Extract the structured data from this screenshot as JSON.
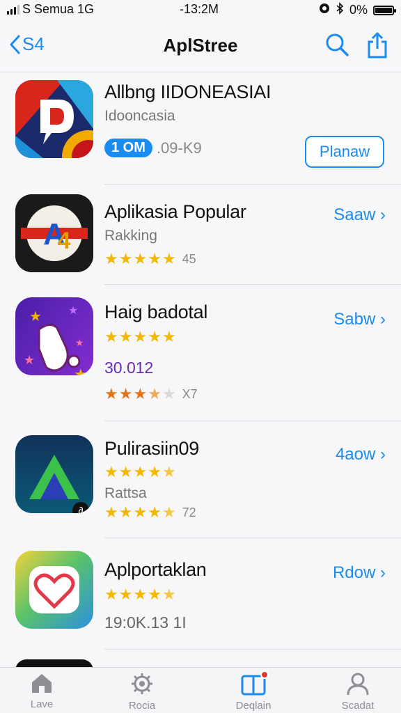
{
  "status_bar": {
    "carrier": "S Semua 1G",
    "time": "-13:2M",
    "battery": "0%"
  },
  "nav": {
    "back_label": "S4",
    "title": "AplStree"
  },
  "apps": [
    {
      "title": "Allbng IIDONEASIAI",
      "subtitle": "Idooncasia",
      "badge": "1 OM",
      "meta": ".09-K9",
      "action": "Planaw"
    },
    {
      "title": "Aplikasia Popular",
      "subtitle": "Rakking",
      "rating": 5,
      "rating_count": "45",
      "action": "Saaw ›"
    },
    {
      "title": "Haig badotal",
      "rating": 5,
      "price": "30.012",
      "rating2": 3.5,
      "rating2_count": "X7",
      "action": "Sabw ›"
    },
    {
      "title": "Pulirasiin09",
      "rating": 4.5,
      "subtitle": "Rattsa",
      "rating2": 4.5,
      "rating2_count": "72",
      "action": "4aow ›"
    },
    {
      "title": "Aplportaklan",
      "rating": 4.5,
      "meta": "19:0K.13 1I",
      "action": "Rdow ›"
    }
  ],
  "tabs": [
    {
      "label": "Lave",
      "icon": "home-icon"
    },
    {
      "label": "Rocia",
      "icon": "settings-gear-icon"
    },
    {
      "label": "Deqlain",
      "icon": "apps-icon"
    },
    {
      "label": "Scadat",
      "icon": "person-icon"
    }
  ],
  "colors": {
    "accent": "#1a8cf0",
    "star": "#f5b800",
    "star_orange": "#e2761a",
    "price_purple": "#6a2bb5"
  }
}
